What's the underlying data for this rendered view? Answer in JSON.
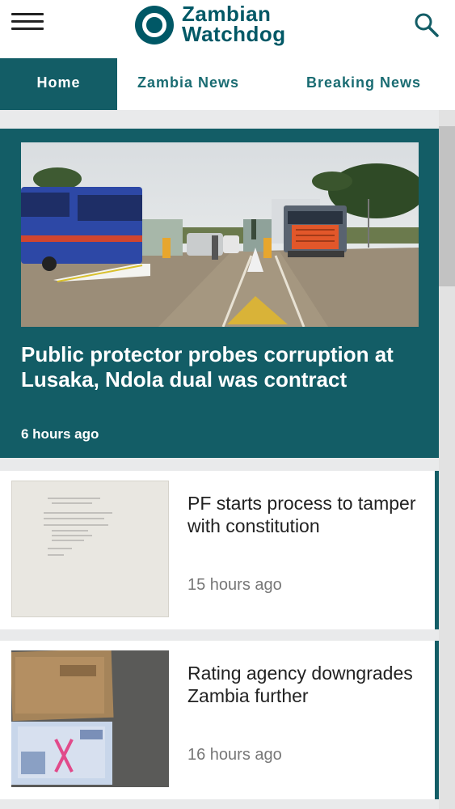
{
  "header": {
    "logo_line1": "Zambian",
    "logo_line2": "Watchdog"
  },
  "tabs": [
    {
      "label": "Home",
      "active": true
    },
    {
      "label": "Zambia News",
      "active": false
    },
    {
      "label": "Breaking News",
      "active": false
    }
  ],
  "featured": {
    "title": "Public protector probes corruption at Lusaka, Ndola dual was contract",
    "time": "6 hours ago"
  },
  "articles": [
    {
      "title": "PF starts process to tamper with constitution",
      "time": "15 hours ago"
    },
    {
      "title": "Rating agency downgrades Zambia further",
      "time": "16 hours ago"
    }
  ],
  "colors": {
    "brand": "#005866",
    "accent": "#135d66",
    "background": "#e9eaeb"
  },
  "icons": {
    "menu": "hamburger-menu-icon",
    "search": "search-icon"
  }
}
